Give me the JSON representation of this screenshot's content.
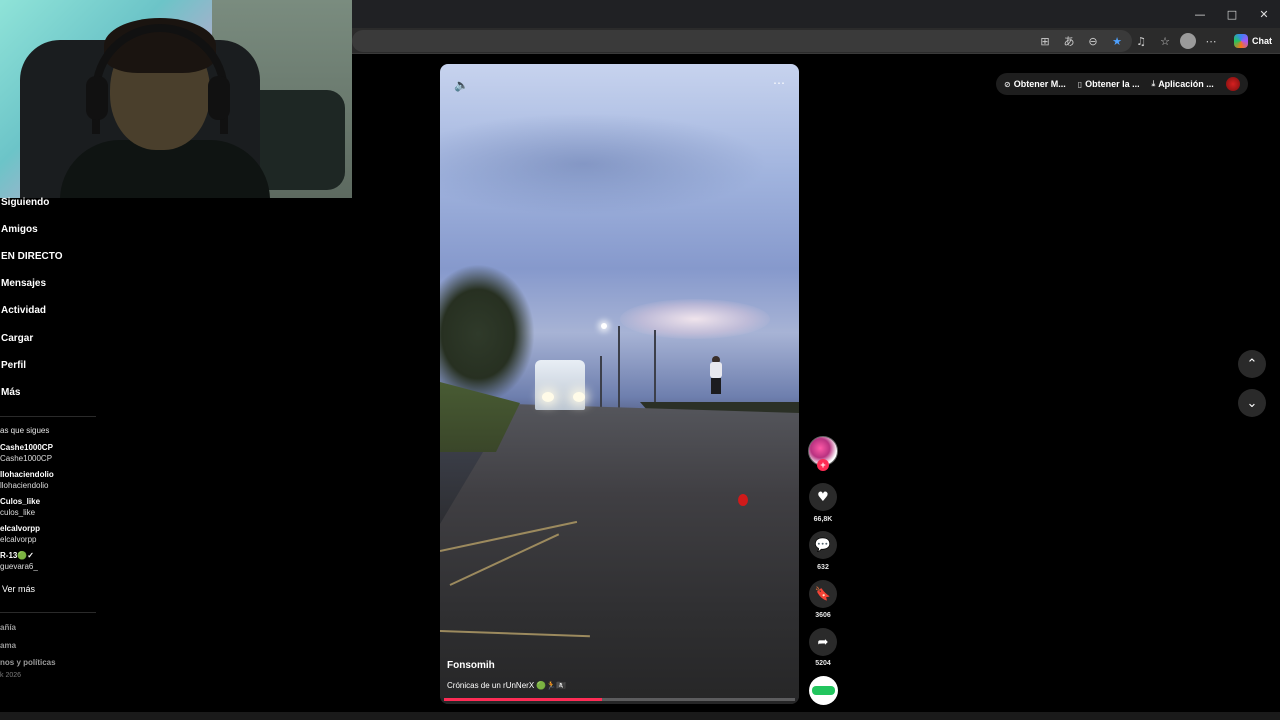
{
  "browser": {
    "window_controls": {
      "minimize": "—",
      "maximize": "□",
      "close": "✕"
    },
    "chat_label": "Chat"
  },
  "sidebar": {
    "nav": [
      {
        "label": "Siguiendo"
      },
      {
        "label": "Amigos"
      },
      {
        "label": "EN DIRECTO"
      },
      {
        "label": "Mensajes"
      },
      {
        "label": "Actividad"
      },
      {
        "label": "Cargar"
      },
      {
        "label": "Perfil"
      },
      {
        "label": "Más"
      }
    ],
    "following_heading": "as que sigues",
    "accounts": [
      {
        "name": "Cashe1000CP",
        "username": "Cashe1000CP"
      },
      {
        "name": "llohaciendolio",
        "username": "llohaciendolio"
      },
      {
        "name": "Culos_like",
        "username": "culos_like"
      },
      {
        "name": "elcalvorpp",
        "username": "elcalvorpp"
      },
      {
        "name": "R-13🟢✓",
        "username": "guevara6_"
      }
    ],
    "see_more": "Ver más",
    "footer_links": [
      "añía",
      "ama",
      "nos y políticas"
    ],
    "copyright": "k 2026"
  },
  "video": {
    "author": "Fonsomih",
    "caption": "Crónicas de un rUnNerX 🟢🏃🏴‍☠️",
    "progress": 0.45
  },
  "actions": {
    "likes": "66,8K",
    "comments": "632",
    "saves": "3606",
    "shares": "5204"
  },
  "top_actions": [
    {
      "icon": "check-circle-icon",
      "label": "Obtener M..."
    },
    {
      "icon": "phone-icon",
      "label": "Obtener la ..."
    },
    {
      "icon": "download-icon",
      "label": "Aplicación ..."
    }
  ],
  "colors": {
    "accent": "#fe2c55",
    "background": "#000000",
    "star": "#4ea1ff"
  }
}
